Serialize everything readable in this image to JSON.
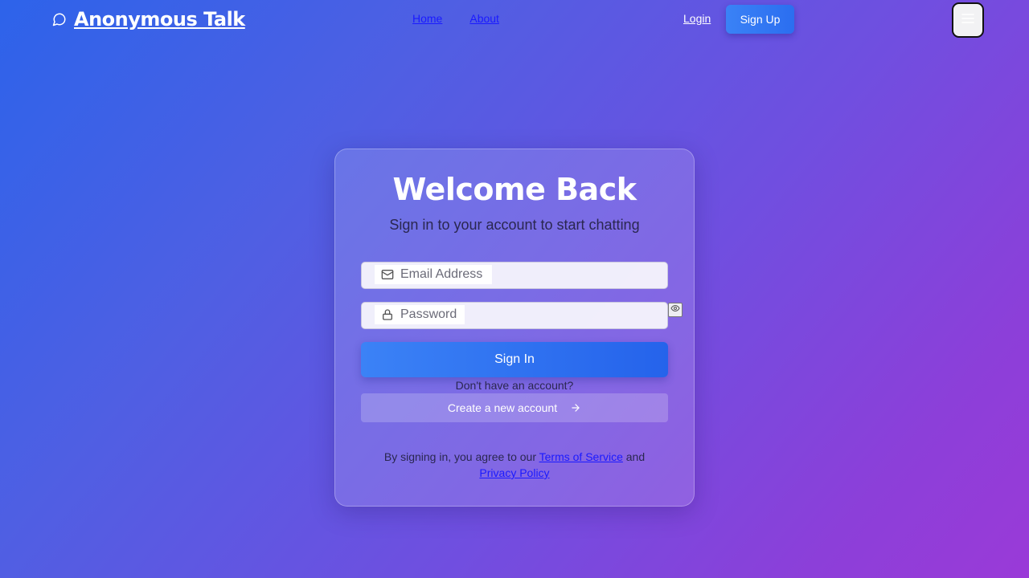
{
  "app": {
    "brand_title": "Anonymous Talk",
    "brand_icon": "chat-bubble-icon"
  },
  "nav": {
    "links": [
      {
        "label": "Home"
      },
      {
        "label": "About"
      }
    ],
    "login_label": "Login",
    "signup_label": "Sign Up",
    "menu_icon": "hamburger-menu-icon"
  },
  "login_card": {
    "title": "Welcome Back",
    "subtitle": "Sign in to your account to start chatting",
    "email": {
      "placeholder": "Email Address",
      "value": "",
      "icon": "mail-icon"
    },
    "password": {
      "placeholder": "Password",
      "value": "",
      "icon": "lock-icon",
      "toggle_icon": "eye-icon"
    },
    "signin_label": "Sign In",
    "no_account_text": "Don't have an account?",
    "create_account_label": "Create a new account",
    "create_account_icon": "arrow-right-icon",
    "legal": {
      "prefix": "By signing in, you agree to our ",
      "terms_label": "Terms of Service",
      "middle": " and ",
      "privacy_label": "Privacy Policy"
    }
  },
  "colors": {
    "gradient_start": "#2d63ea",
    "gradient_end": "#9a3ad8",
    "primary_button": "#3b82f6",
    "link": "#1a1aff"
  }
}
